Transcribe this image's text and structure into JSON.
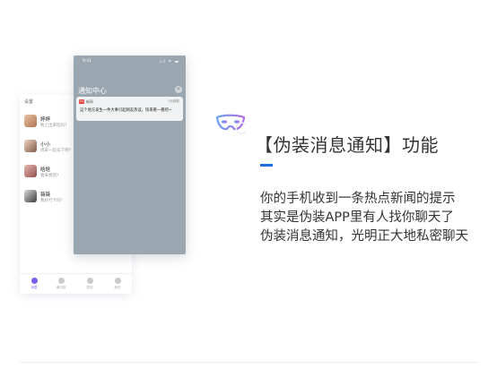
{
  "colors": {
    "accent": "#1a73d8",
    "phone_overlay": "#9aa6b0",
    "tab_active": "#7b5cf0",
    "news_icon": "#e0332b"
  },
  "back_phone": {
    "header": "设置",
    "chats": [
      {
        "name": "婷婷",
        "message": "晚上出来吃吗?"
      },
      {
        "name": "小小",
        "message": "周末一起去下吧?"
      },
      {
        "name": "晗晗",
        "message": "看来想到?"
      },
      {
        "name": "薇薇",
        "message": "我好打卡吗?"
      }
    ],
    "tabs": [
      {
        "label": "消息",
        "icon": "chat-icon"
      },
      {
        "label": "通讯录",
        "icon": "contacts-icon"
      },
      {
        "label": "发现",
        "icon": "compass-icon"
      },
      {
        "label": "我的",
        "icon": "profile-icon"
      }
    ]
  },
  "front_phone": {
    "time": "9:41",
    "status": "ııl ᯤ ▬",
    "title": "通知中心",
    "close_icon": "✕",
    "notification": {
      "app_badge": "新闻",
      "app_name": "新闻",
      "time": "1分钟前",
      "body": "这个地方发生一件大事引起网友热议，快来看一看吧~"
    }
  },
  "content": {
    "title": "【伪装消息通知】功能",
    "lines": [
      "你的手机收到一条热点新闻的提示",
      "其实是伪装APP里有人找你聊天了",
      "伪装消息通知，光明正大地私密聊天"
    ]
  }
}
